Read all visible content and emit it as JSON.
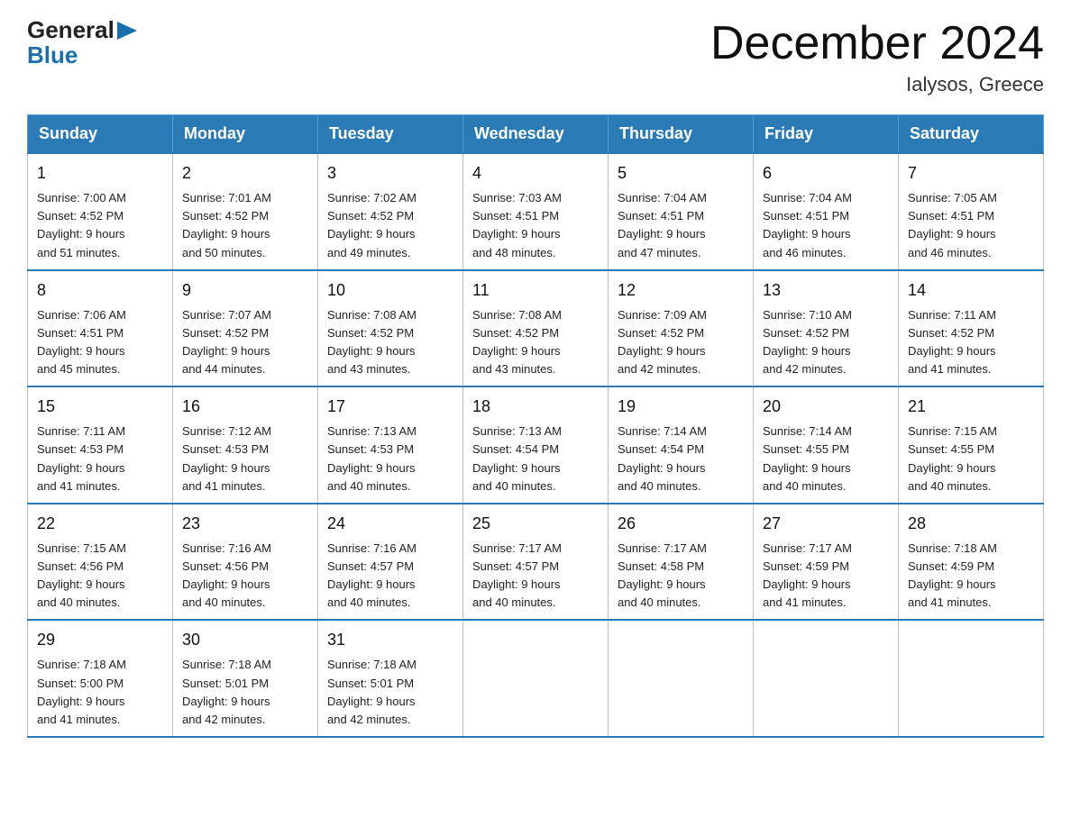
{
  "logo": {
    "general": "General",
    "blue": "Blue",
    "arrow": "▶"
  },
  "title": {
    "month_year": "December 2024",
    "location": "Ialysos, Greece"
  },
  "headers": [
    "Sunday",
    "Monday",
    "Tuesday",
    "Wednesday",
    "Thursday",
    "Friday",
    "Saturday"
  ],
  "weeks": [
    [
      {
        "day": "1",
        "sunrise": "7:00 AM",
        "sunset": "4:52 PM",
        "daylight": "9 hours and 51 minutes."
      },
      {
        "day": "2",
        "sunrise": "7:01 AM",
        "sunset": "4:52 PM",
        "daylight": "9 hours and 50 minutes."
      },
      {
        "day": "3",
        "sunrise": "7:02 AM",
        "sunset": "4:52 PM",
        "daylight": "9 hours and 49 minutes."
      },
      {
        "day": "4",
        "sunrise": "7:03 AM",
        "sunset": "4:51 PM",
        "daylight": "9 hours and 48 minutes."
      },
      {
        "day": "5",
        "sunrise": "7:04 AM",
        "sunset": "4:51 PM",
        "daylight": "9 hours and 47 minutes."
      },
      {
        "day": "6",
        "sunrise": "7:04 AM",
        "sunset": "4:51 PM",
        "daylight": "9 hours and 46 minutes."
      },
      {
        "day": "7",
        "sunrise": "7:05 AM",
        "sunset": "4:51 PM",
        "daylight": "9 hours and 46 minutes."
      }
    ],
    [
      {
        "day": "8",
        "sunrise": "7:06 AM",
        "sunset": "4:51 PM",
        "daylight": "9 hours and 45 minutes."
      },
      {
        "day": "9",
        "sunrise": "7:07 AM",
        "sunset": "4:52 PM",
        "daylight": "9 hours and 44 minutes."
      },
      {
        "day": "10",
        "sunrise": "7:08 AM",
        "sunset": "4:52 PM",
        "daylight": "9 hours and 43 minutes."
      },
      {
        "day": "11",
        "sunrise": "7:08 AM",
        "sunset": "4:52 PM",
        "daylight": "9 hours and 43 minutes."
      },
      {
        "day": "12",
        "sunrise": "7:09 AM",
        "sunset": "4:52 PM",
        "daylight": "9 hours and 42 minutes."
      },
      {
        "day": "13",
        "sunrise": "7:10 AM",
        "sunset": "4:52 PM",
        "daylight": "9 hours and 42 minutes."
      },
      {
        "day": "14",
        "sunrise": "7:11 AM",
        "sunset": "4:52 PM",
        "daylight": "9 hours and 41 minutes."
      }
    ],
    [
      {
        "day": "15",
        "sunrise": "7:11 AM",
        "sunset": "4:53 PM",
        "daylight": "9 hours and 41 minutes."
      },
      {
        "day": "16",
        "sunrise": "7:12 AM",
        "sunset": "4:53 PM",
        "daylight": "9 hours and 41 minutes."
      },
      {
        "day": "17",
        "sunrise": "7:13 AM",
        "sunset": "4:53 PM",
        "daylight": "9 hours and 40 minutes."
      },
      {
        "day": "18",
        "sunrise": "7:13 AM",
        "sunset": "4:54 PM",
        "daylight": "9 hours and 40 minutes."
      },
      {
        "day": "19",
        "sunrise": "7:14 AM",
        "sunset": "4:54 PM",
        "daylight": "9 hours and 40 minutes."
      },
      {
        "day": "20",
        "sunrise": "7:14 AM",
        "sunset": "4:55 PM",
        "daylight": "9 hours and 40 minutes."
      },
      {
        "day": "21",
        "sunrise": "7:15 AM",
        "sunset": "4:55 PM",
        "daylight": "9 hours and 40 minutes."
      }
    ],
    [
      {
        "day": "22",
        "sunrise": "7:15 AM",
        "sunset": "4:56 PM",
        "daylight": "9 hours and 40 minutes."
      },
      {
        "day": "23",
        "sunrise": "7:16 AM",
        "sunset": "4:56 PM",
        "daylight": "9 hours and 40 minutes."
      },
      {
        "day": "24",
        "sunrise": "7:16 AM",
        "sunset": "4:57 PM",
        "daylight": "9 hours and 40 minutes."
      },
      {
        "day": "25",
        "sunrise": "7:17 AM",
        "sunset": "4:57 PM",
        "daylight": "9 hours and 40 minutes."
      },
      {
        "day": "26",
        "sunrise": "7:17 AM",
        "sunset": "4:58 PM",
        "daylight": "9 hours and 40 minutes."
      },
      {
        "day": "27",
        "sunrise": "7:17 AM",
        "sunset": "4:59 PM",
        "daylight": "9 hours and 41 minutes."
      },
      {
        "day": "28",
        "sunrise": "7:18 AM",
        "sunset": "4:59 PM",
        "daylight": "9 hours and 41 minutes."
      }
    ],
    [
      {
        "day": "29",
        "sunrise": "7:18 AM",
        "sunset": "5:00 PM",
        "daylight": "9 hours and 41 minutes."
      },
      {
        "day": "30",
        "sunrise": "7:18 AM",
        "sunset": "5:01 PM",
        "daylight": "9 hours and 42 minutes."
      },
      {
        "day": "31",
        "sunrise": "7:18 AM",
        "sunset": "5:01 PM",
        "daylight": "9 hours and 42 minutes."
      },
      null,
      null,
      null,
      null
    ]
  ],
  "labels": {
    "sunrise": "Sunrise: ",
    "sunset": "Sunset: ",
    "daylight": "Daylight: "
  }
}
